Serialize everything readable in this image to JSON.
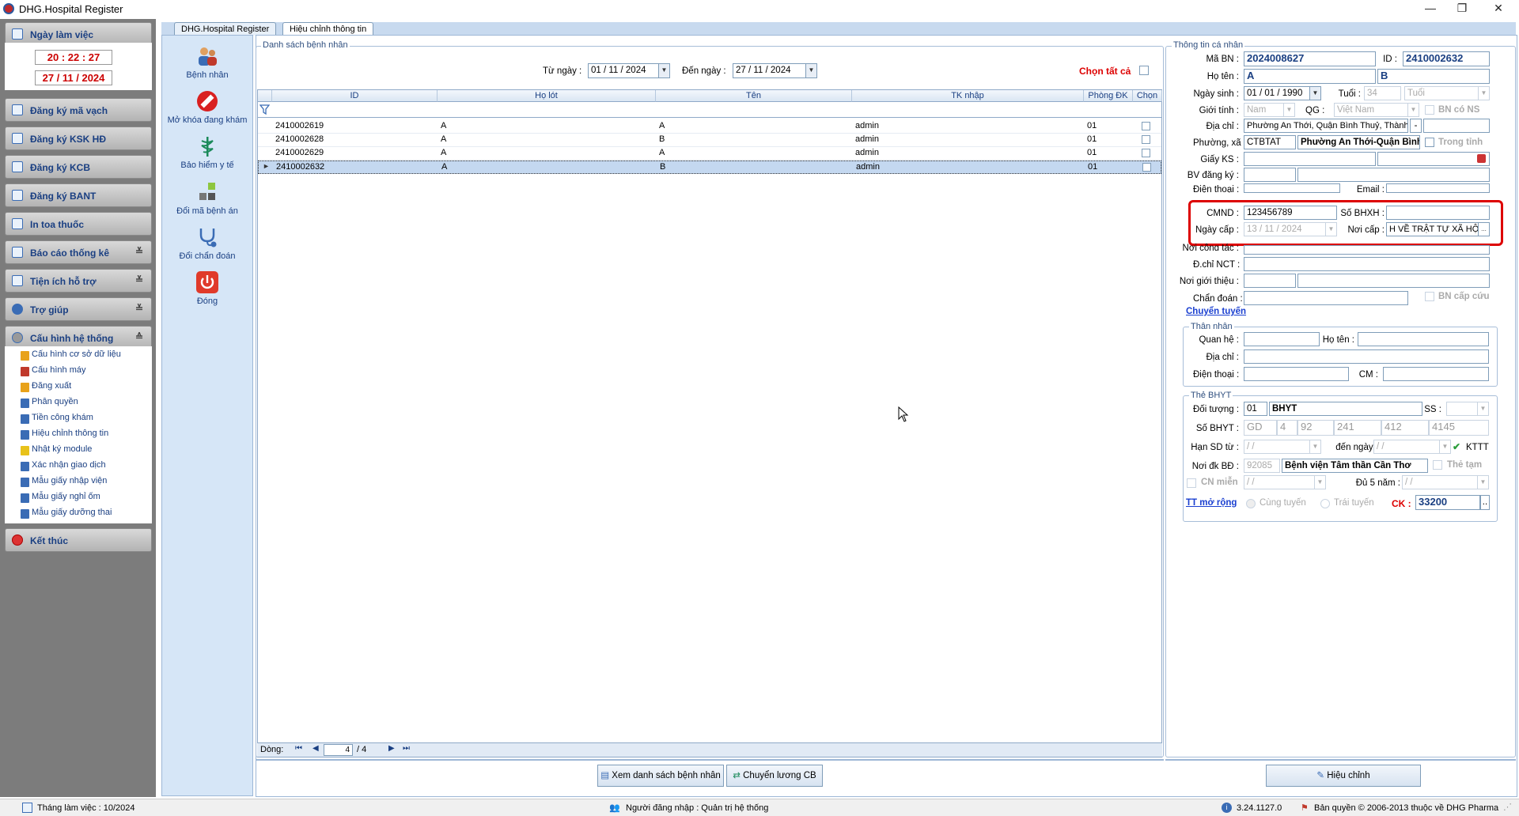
{
  "window": {
    "title": "DHG.Hospital Register",
    "minimize": "—",
    "maximize": "❐",
    "close": "✕"
  },
  "sidebar": {
    "workday_label": "Ngày làm việc",
    "time": "20 : 22 : 27",
    "date": "27 / 11 / 2024",
    "items": [
      {
        "label": "Đăng ký mã vạch"
      },
      {
        "label": "Đăng ký KSK HĐ"
      },
      {
        "label": "Đăng ký KCB"
      },
      {
        "label": "Đăng ký BANT"
      },
      {
        "label": "In toa thuốc"
      },
      {
        "label": "Báo cáo thống kê",
        "chev": "≚"
      },
      {
        "label": "Tiện ích hỗ trợ",
        "chev": "≚"
      },
      {
        "label": "Trợ giúp",
        "chev": "≚"
      },
      {
        "label": "Cấu hình hệ thống",
        "chev": "≙"
      }
    ],
    "submenu": [
      "Cấu hình cơ sở dữ liệu",
      "Cấu hình máy",
      "Đăng xuất",
      "Phân quyền",
      "Tiền công khám",
      "Hiệu chỉnh thông tin",
      "Nhật ký module",
      "Xác nhận giao dịch",
      "Mẫu giấy nhập viện",
      "Mẫu giấy nghỉ ốm",
      "Mẫu giấy dưỡng thai"
    ],
    "exit": "Kết thúc"
  },
  "tabs": [
    "DHG.Hospital Register",
    "Hiệu chỉnh thông tin"
  ],
  "tools": [
    "Bệnh nhân",
    "Mở khóa đang khám",
    "Bảo hiểm y tế",
    "Đổi mã bệnh án",
    "Đổi chẩn đoán",
    "Đóng"
  ],
  "list": {
    "legend": "Danh sách bệnh nhân",
    "from_label": "Từ ngày :",
    "from_value": "01 / 11 / 2024",
    "to_label": "Đến  ngày :",
    "to_value": "27 / 11 / 2024",
    "select_all": "Chọn tất cả",
    "columns": [
      "ID",
      "Họ lót",
      "Tên",
      "TK nhập",
      "Phòng ĐK",
      "Chọn"
    ],
    "rows": [
      {
        "id": "2410002619",
        "holot": "A",
        "ten": "A",
        "tk": "admin",
        "phong": "01"
      },
      {
        "id": "2410002628",
        "holot": "A",
        "ten": "B",
        "tk": "admin",
        "phong": "01"
      },
      {
        "id": "2410002629",
        "holot": "A",
        "ten": "A",
        "tk": "admin",
        "phong": "01"
      },
      {
        "id": "2410002632",
        "holot": "A",
        "ten": "B",
        "tk": "admin",
        "phong": "01"
      }
    ],
    "nav_label": "Dòng:",
    "nav_current": "4",
    "nav_total": "/   4",
    "btn_view": "Xem danh sách bệnh nhân",
    "btn_transfer": "Chuyển lương CB"
  },
  "info": {
    "legend": "Thông tin cá nhân",
    "ma_bn_label": "Mã BN :",
    "ma_bn": "2024008627",
    "id_label": "ID :",
    "id": "2410002632",
    "ho_ten_label": "Họ tên :",
    "ho": "A",
    "ten": "B",
    "ngay_sinh_label": "Ngày sinh :",
    "ngay_sinh": "01 / 01 / 1990",
    "tuoi_label": "Tuổi :",
    "tuoi": "34",
    "tuoi_unit": "Tuổi",
    "gioi_tinh_label": "Giới tính :",
    "gioi_tinh": "Nam",
    "qg_label": "QG :",
    "qg": "Việt Nam",
    "bn_co_ns": "BN có NS",
    "dia_chi_label": "Địa chỉ :",
    "dia_chi": "Phường An Thới, Quận Bình Thuỷ, Thành p",
    "phuong_label": "Phường, xã :",
    "phuong_code": "CTBTAT",
    "phuong_name": "Phường An Thới-Quận Bình",
    "trong_tinh": "Trong tỉnh",
    "giay_ks_label": "Giấy KS :",
    "bv_dk_label": "BV đăng ký :",
    "dien_thoai_label": "Điện thoại :",
    "email_label": "Email :",
    "cmnd_label": "CMND :",
    "cmnd": "123456789",
    "so_bhxh_label": "Số BHXH :",
    "ngay_cap_label": "Ngày cấp :",
    "ngay_cap": "13 / 11 / 2024",
    "noi_cap_label": "Nơi cấp :",
    "noi_cap": "H VỀ TRẬT TỰ XÃ HỘI",
    "noi_cong_tac_label": "Nơi công tác :",
    "dchi_nct_label": "Đ.chỉ NCT :",
    "noi_gioi_thieu_label": "Nơi giới thiệu :",
    "chan_doan_label": "Chẩn đoán :",
    "bn_cap_cuu": "BN cấp cứu",
    "chuyen_tuyen": "Chuyển tuyến"
  },
  "relative": {
    "legend": "Thân nhân",
    "quan_he_label": "Quan hệ :",
    "ho_ten_label": "Họ tên :",
    "dia_chi_label": "Địa chỉ :",
    "dien_thoai_label": "Điện thoại :",
    "cm_label": "CM :"
  },
  "bhyt": {
    "legend": "Thẻ BHYT",
    "doi_tuong_label": "Đối tượng :",
    "doi_tuong_code": "01",
    "doi_tuong_name": "BHYT",
    "ss_label": "SS :",
    "so_bhyt_label": "Số BHYT :",
    "so_parts": [
      "GD",
      "4",
      "92",
      "241",
      "412",
      "4145"
    ],
    "han_sd_label": "Hạn SD từ :",
    "han_from": "/       /",
    "den_ngay_label": "đến  ngày :",
    "han_to": "/       /",
    "kttt": "KTTT",
    "noi_dk_label": "Nơi đk BĐ :",
    "noi_dk_code": "92085",
    "noi_dk_name": "Bệnh viện Tâm thần Cần Thơ",
    "the_tam": "Thẻ tạm",
    "cn_mien": "CN miễn",
    "cn_mien_value": "/       /",
    "du5nam_label": "Đủ 5 năm :",
    "du5nam_value": "/       /",
    "tt_mo_rong": "TT mở rộng",
    "cung_tuyen": "Cùng tuyến",
    "trai_tuyen": "Trái tuyến",
    "ck_label": "CK :",
    "ck": "33200",
    "btn_edit": "Hiệu chỉnh"
  },
  "status": {
    "month": "Tháng làm việc : 10/2024",
    "user": "Người đăng nhập : Quản trị hệ thống",
    "version": "3.24.1127.0",
    "copyright": "Bản quyền © 2006-2013 thuộc về DHG Pharma"
  }
}
